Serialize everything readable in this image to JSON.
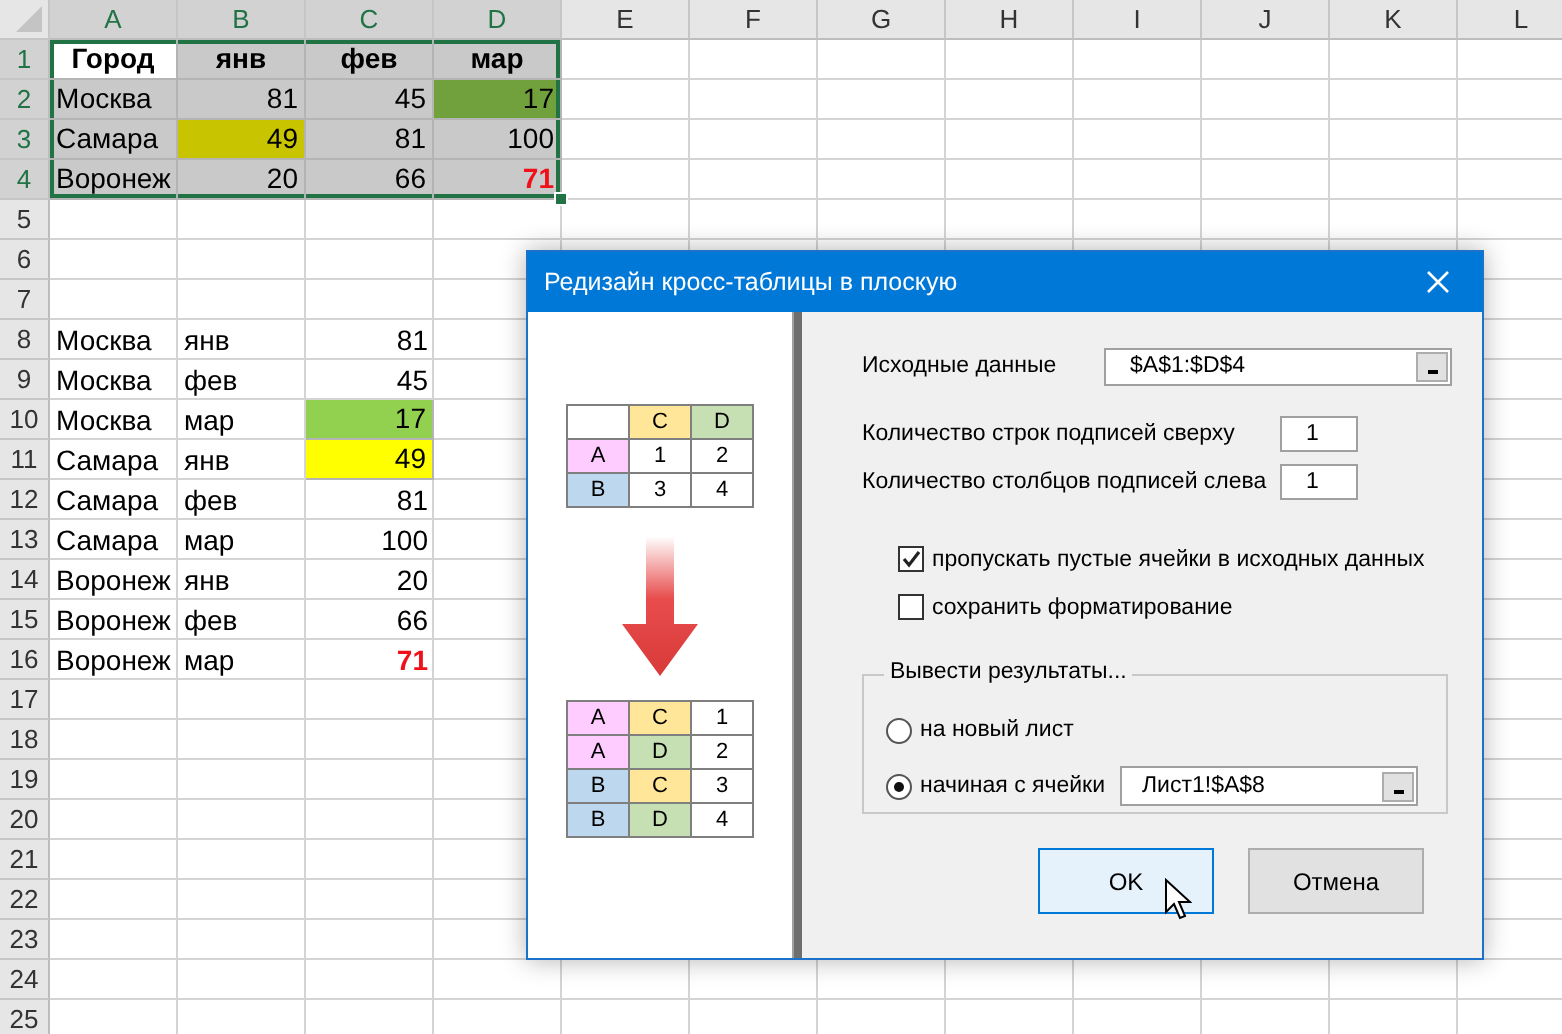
{
  "sheet": {
    "columns": [
      {
        "label": "A",
        "selected": true
      },
      {
        "label": "B",
        "selected": true
      },
      {
        "label": "C",
        "selected": true
      },
      {
        "label": "D",
        "selected": true
      },
      {
        "label": "E",
        "selected": false
      },
      {
        "label": "F",
        "selected": false
      },
      {
        "label": "G",
        "selected": false
      },
      {
        "label": "H",
        "selected": false
      },
      {
        "label": "I",
        "selected": false
      },
      {
        "label": "J",
        "selected": false
      },
      {
        "label": "K",
        "selected": false
      },
      {
        "label": "L",
        "selected": false
      }
    ],
    "rows": [
      {
        "number": "1",
        "selected": true,
        "cells": [
          {
            "text": "Город",
            "kind": "header",
            "color": "#ffffff"
          },
          {
            "text": "янв",
            "kind": "header",
            "color": "#c9c9c9"
          },
          {
            "text": "фев",
            "kind": "header",
            "color": "#c9c9c9"
          },
          {
            "text": "мар",
            "kind": "header",
            "color": "#c9c9c9"
          }
        ]
      },
      {
        "number": "2",
        "selected": true,
        "cells": [
          {
            "text": "Москва",
            "kind": "text",
            "color": "#c9c9c9"
          },
          {
            "text": "81",
            "kind": "number",
            "color": "#c9c9c9"
          },
          {
            "text": "45",
            "kind": "number",
            "color": "#c9c9c9"
          },
          {
            "text": "17",
            "kind": "number",
            "color": "#70a13c"
          }
        ]
      },
      {
        "number": "3",
        "selected": true,
        "cells": [
          {
            "text": "Самара",
            "kind": "text",
            "color": "#c9c9c9"
          },
          {
            "text": "49",
            "kind": "number",
            "color": "#c8c400"
          },
          {
            "text": "81",
            "kind": "number",
            "color": "#c9c9c9"
          },
          {
            "text": "100",
            "kind": "number",
            "color": "#c9c9c9"
          }
        ]
      },
      {
        "number": "4",
        "selected": true,
        "cells": [
          {
            "text": "Воронеж",
            "kind": "text",
            "color": "#c9c9c9"
          },
          {
            "text": "20",
            "kind": "number",
            "color": "#c9c9c9"
          },
          {
            "text": "66",
            "kind": "number",
            "color": "#c9c9c9"
          },
          {
            "text": "71",
            "kind": "number",
            "color": "#c9c9c9",
            "alert": true
          }
        ]
      },
      {
        "number": "5",
        "selected": false
      },
      {
        "number": "6",
        "selected": false
      },
      {
        "number": "7",
        "selected": false
      },
      {
        "number": "8",
        "selected": false,
        "cells": [
          {
            "text": "Москва",
            "kind": "text"
          },
          {
            "text": "янв",
            "kind": "text"
          },
          {
            "text": "81",
            "kind": "number"
          }
        ]
      },
      {
        "number": "9",
        "selected": false,
        "cells": [
          {
            "text": "Москва",
            "kind": "text"
          },
          {
            "text": "фев",
            "kind": "text"
          },
          {
            "text": "45",
            "kind": "number"
          }
        ]
      },
      {
        "number": "10",
        "selected": false,
        "cells": [
          {
            "text": "Москва",
            "kind": "text"
          },
          {
            "text": "мар",
            "kind": "text"
          },
          {
            "text": "17",
            "kind": "number",
            "color": "#92d050"
          }
        ]
      },
      {
        "number": "11",
        "selected": false,
        "cells": [
          {
            "text": "Самара",
            "kind": "text"
          },
          {
            "text": "янв",
            "kind": "text"
          },
          {
            "text": "49",
            "kind": "number",
            "color": "#ffff00"
          }
        ]
      },
      {
        "number": "12",
        "selected": false,
        "cells": [
          {
            "text": "Самара",
            "kind": "text"
          },
          {
            "text": "фев",
            "kind": "text"
          },
          {
            "text": "81",
            "kind": "number"
          }
        ]
      },
      {
        "number": "13",
        "selected": false,
        "cells": [
          {
            "text": "Самара",
            "kind": "text"
          },
          {
            "text": "мар",
            "kind": "text"
          },
          {
            "text": "100",
            "kind": "number"
          }
        ]
      },
      {
        "number": "14",
        "selected": false,
        "cells": [
          {
            "text": "Воронеж",
            "kind": "text"
          },
          {
            "text": "янв",
            "kind": "text"
          },
          {
            "text": "20",
            "kind": "number"
          }
        ]
      },
      {
        "number": "15",
        "selected": false,
        "cells": [
          {
            "text": "Воронеж",
            "kind": "text"
          },
          {
            "text": "фев",
            "kind": "text"
          },
          {
            "text": "66",
            "kind": "number"
          }
        ]
      },
      {
        "number": "16",
        "selected": false,
        "cells": [
          {
            "text": "Воронеж",
            "kind": "text"
          },
          {
            "text": "мар",
            "kind": "text"
          },
          {
            "text": "71",
            "kind": "number",
            "alert": true
          }
        ]
      },
      {
        "number": "17",
        "selected": false
      },
      {
        "number": "18",
        "selected": false
      },
      {
        "number": "19",
        "selected": false
      },
      {
        "number": "20",
        "selected": false
      },
      {
        "number": "21",
        "selected": false
      },
      {
        "number": "22",
        "selected": false
      },
      {
        "number": "23",
        "selected": false
      },
      {
        "number": "24",
        "selected": false
      },
      {
        "number": "25",
        "selected": false
      }
    ]
  },
  "dialog": {
    "title": "Редизайн кросс-таблицы в плоскую",
    "source_table": {
      "columns": [
        {
          "text": "C",
          "color": "#ffe699"
        },
        {
          "text": "D",
          "color": "#c6e0b4"
        }
      ],
      "rows": [
        {
          "label": {
            "text": "A",
            "color": "#ffccff"
          },
          "values": [
            "1",
            "2"
          ]
        },
        {
          "label": {
            "text": "B",
            "color": "#bdd7ee"
          },
          "values": [
            "3",
            "4"
          ]
        }
      ]
    },
    "result_table": [
      {
        "cells": [
          {
            "text": "A",
            "color": "#ffccff"
          },
          {
            "text": "C",
            "color": "#ffe699"
          },
          {
            "text": "1"
          }
        ]
      },
      {
        "cells": [
          {
            "text": "A",
            "color": "#ffccff"
          },
          {
            "text": "D",
            "color": "#c6e0b4"
          },
          {
            "text": "2"
          }
        ]
      },
      {
        "cells": [
          {
            "text": "B",
            "color": "#bdd7ee"
          },
          {
            "text": "C",
            "color": "#ffe699"
          },
          {
            "text": "3"
          }
        ]
      },
      {
        "cells": [
          {
            "text": "B",
            "color": "#bdd7ee"
          },
          {
            "text": "D",
            "color": "#c6e0b4"
          },
          {
            "text": "4"
          }
        ]
      }
    ],
    "source_range": {
      "label": "Исходные данные",
      "value": "$A$1:$D$4"
    },
    "counts": [
      {
        "label": "Количество строк подписей сверху",
        "value": "1"
      },
      {
        "label": "Количество столбцов подписей слева",
        "value": "1"
      }
    ],
    "checkboxes": [
      {
        "label": "пропускать пустые ячейки в исходных данных",
        "checked": true
      },
      {
        "label": "сохранить форматирование",
        "checked": false
      }
    ],
    "output": {
      "title": "Вывести результаты...",
      "options": [
        {
          "label": "на новый лист",
          "selected": false
        },
        {
          "label": "начиная с ячейки",
          "selected": true
        }
      ],
      "target": "Лист1!$A$8"
    },
    "buttons": [
      {
        "label": "OK",
        "hovered": true
      },
      {
        "label": "Отмена",
        "hovered": false
      }
    ]
  }
}
